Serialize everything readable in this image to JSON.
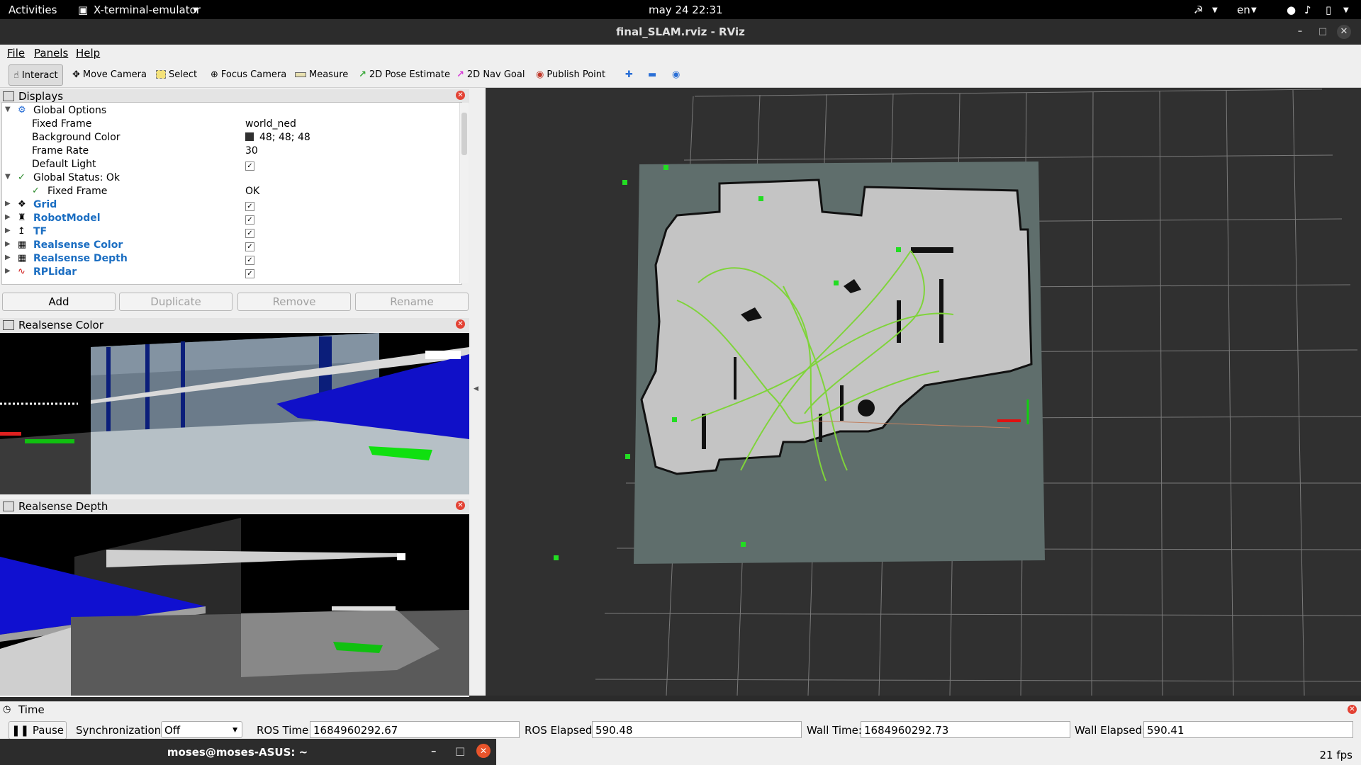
{
  "topbar": {
    "activities": "Activities",
    "app_menu": "X-terminal-emulator",
    "clock": "may 24  22:31",
    "lang": "en"
  },
  "window": {
    "title": "final_SLAM.rviz - RViz"
  },
  "menu": [
    "File",
    "Panels",
    "Help"
  ],
  "toolbar": {
    "interact": "Interact",
    "move_camera": "Move Camera",
    "select": "Select",
    "focus_camera": "Focus Camera",
    "measure": "Measure",
    "pose_estimate": "2D Pose Estimate",
    "nav_goal": "2D Nav Goal",
    "publish_point": "Publish Point"
  },
  "displays": {
    "title": "Displays",
    "rows": [
      {
        "label": "Global Options",
        "value": ""
      },
      {
        "label": "Fixed Frame",
        "value": "world_ned"
      },
      {
        "label": "Background Color",
        "value": "48; 48; 48"
      },
      {
        "label": "Frame Rate",
        "value": "30"
      },
      {
        "label": "Default Light",
        "value": "✓"
      },
      {
        "label": "Global Status: Ok",
        "value": ""
      },
      {
        "label": "Fixed Frame",
        "value": "OK"
      },
      {
        "label": "Grid",
        "value": "✓"
      },
      {
        "label": "RobotModel",
        "value": "✓"
      },
      {
        "label": "TF",
        "value": "✓"
      },
      {
        "label": "Realsense Color",
        "value": "✓"
      },
      {
        "label": "Realsense Depth",
        "value": "✓"
      },
      {
        "label": "RPLidar",
        "value": "✓"
      }
    ],
    "buttons": {
      "add": "Add",
      "duplicate": "Duplicate",
      "remove": "Remove",
      "rename": "Rename"
    }
  },
  "panels": {
    "realsense_color": "Realsense Color",
    "realsense_depth": "Realsense Depth",
    "time": "Time"
  },
  "time": {
    "pause": "Pause",
    "sync_label": "Synchronization:",
    "sync_value": "Off",
    "ros_time_label": "ROS Time:",
    "ros_time": "1684960292.67",
    "ros_elapsed_label": "ROS Elapsed:",
    "ros_elapsed": "590.48",
    "wall_time_label": "Wall Time:",
    "wall_time": "1684960292.73",
    "wall_elapsed_label": "Wall Elapsed:",
    "wall_elapsed": "590.41"
  },
  "status": {
    "fps": "21 fps"
  },
  "terminal": {
    "title": "moses@moses-ASUS: ~"
  },
  "colors": {
    "background": "#303030",
    "map_free": "#c4c4c4",
    "map_unknown": "#5f6e6c",
    "path": "#7fd43a",
    "accent_blue": "#1b6ec2",
    "close_red": "#e34234"
  }
}
